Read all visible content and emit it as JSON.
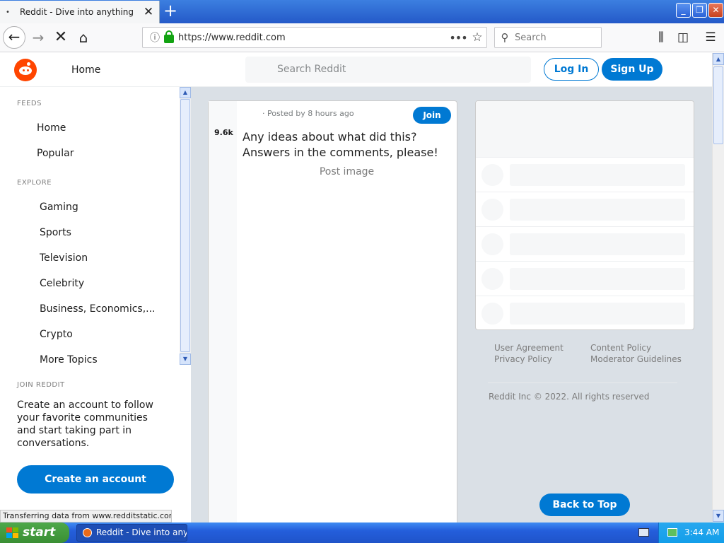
{
  "browser": {
    "tab_title": "Reddit - Dive into anything",
    "tab_dot": "•",
    "tab_close": "✕",
    "new_tab": "+",
    "url": "https://www.reddit.com",
    "search_placeholder": "Search",
    "page_actions": "•••",
    "status": "Transferring data from www.redditstatic.com..."
  },
  "reddit_header": {
    "home_label": "Home",
    "search_placeholder": "Search Reddit",
    "login_label": "Log In",
    "signup_label": "Sign Up",
    "brand_color": "#ff4500",
    "accent_color": "#0079d3"
  },
  "sidebar": {
    "feeds_label": "FEEDS",
    "feeds": [
      "Home",
      "Popular"
    ],
    "explore_label": "EXPLORE",
    "explore": [
      "Gaming",
      "Sports",
      "Television",
      "Celebrity",
      "Business, Economics,...",
      "Crypto",
      "More Topics"
    ],
    "join_label": "JOIN REDDIT",
    "join_text": "Create an account to follow your favorite communities and start taking part in conversations.",
    "create_account_label": "Create an account"
  },
  "post": {
    "meta": "· Posted by 8 hours ago",
    "join_label": "Join",
    "score": "9.6k",
    "title": "Any ideas about what did this? Answers in the comments, please!",
    "image_alt": "Post image"
  },
  "footer": {
    "links_col1": [
      "User Agreement",
      "Privacy Policy"
    ],
    "links_col2": [
      "Content Policy",
      "Moderator Guidelines"
    ],
    "copyright": "Reddit Inc © 2022. All rights reserved",
    "back_to_top_label": "Back to Top"
  },
  "taskbar": {
    "start_label": "start",
    "task_label": "Reddit - Dive into any...",
    "clock": "3:44 AM"
  }
}
